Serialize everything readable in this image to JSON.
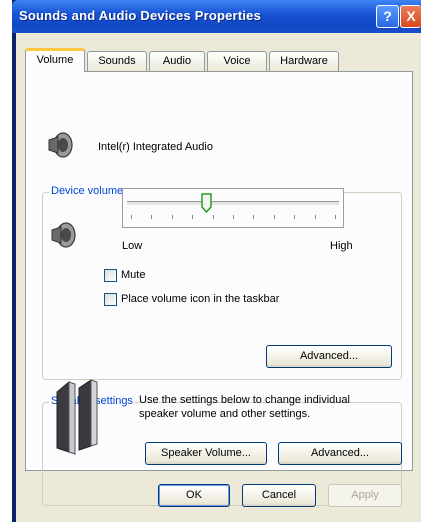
{
  "window": {
    "title": "Sounds and Audio Devices Properties",
    "help_label": "?",
    "close_label": "X"
  },
  "tabs": [
    "Volume",
    "Sounds",
    "Audio",
    "Voice",
    "Hardware"
  ],
  "device": {
    "name": "Intel(r) Integrated Audio"
  },
  "device_volume": {
    "group_label": "Device volume",
    "low_label": "Low",
    "high_label": "High",
    "level_percent": 37,
    "mute_label": "Mute",
    "mute_checked": false,
    "taskbar_label": "Place volume icon in the taskbar",
    "taskbar_checked": false,
    "advanced_label": "Advanced..."
  },
  "speaker_settings": {
    "group_label": "Speaker settings",
    "description": [
      "Use the settings below to change individual",
      "speaker volume and other settings."
    ],
    "speaker_volume_label": "Speaker Volume...",
    "advanced_label": "Advanced..."
  },
  "footer": {
    "ok_label": "OK",
    "cancel_label": "Cancel",
    "apply_label": "Apply"
  }
}
